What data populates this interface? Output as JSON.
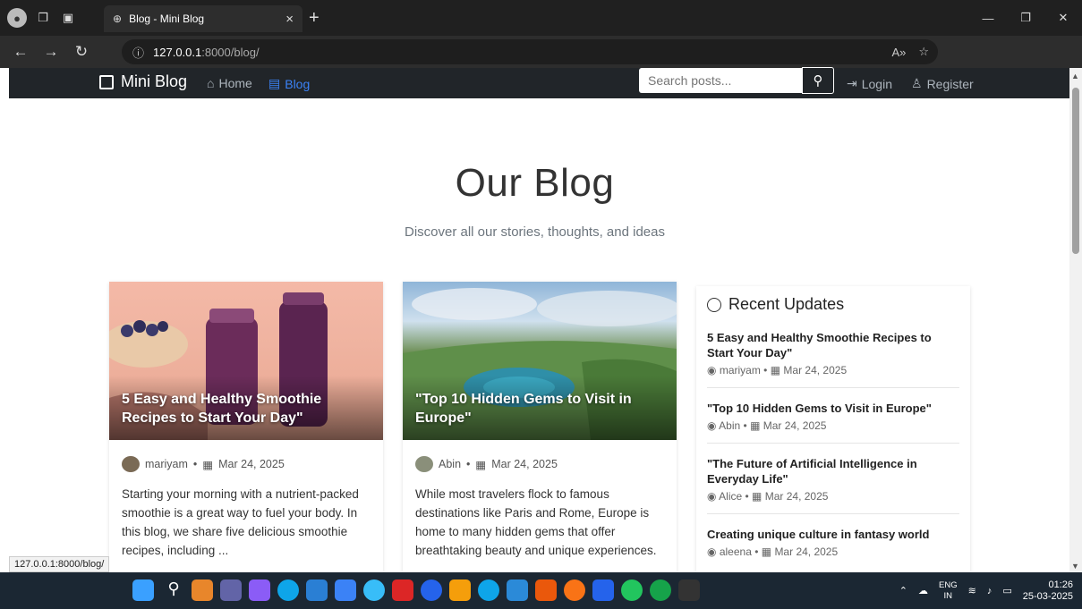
{
  "browser": {
    "tab_title": "Blog - Mini Blog",
    "url_host": "127.0.0.1",
    "url_path": ":8000/blog/",
    "status_url": "127.0.0.1:8000/blog/"
  },
  "navbar": {
    "brand": "Mini Blog",
    "links": {
      "home": "Home",
      "blog": "Blog",
      "login": "Login",
      "register": "Register"
    },
    "search_placeholder": "Search posts..."
  },
  "hero": {
    "title": "Our Blog",
    "subtitle": "Discover all our stories, thoughts, and ideas"
  },
  "posts": [
    {
      "title": "5 Easy and Healthy Smoothie Recipes to Start Your Day\"",
      "author": "mariyam",
      "date": "Mar 24, 2025",
      "excerpt": "Starting your morning with a nutrient-packed smoothie is a great way to fuel your body. In this blog, we share five delicious smoothie recipes, including ..."
    },
    {
      "title": "\"Top 10 Hidden Gems to Visit in Europe\"",
      "author": "Abin",
      "date": "Mar 24, 2025",
      "excerpt": "While most travelers flock to famous destinations like Paris and Rome, Europe is home to many hidden gems that offer breathtaking beauty and unique experiences."
    }
  ],
  "sidebar": {
    "title": "Recent Updates",
    "items": [
      {
        "title": "5 Easy and Healthy Smoothie Recipes to Start Your Day\"",
        "author": "mariyam",
        "date": "Mar 24, 2025"
      },
      {
        "title": "\"Top 10 Hidden Gems to Visit in Europe\"",
        "author": "Abin",
        "date": "Mar 24, 2025"
      },
      {
        "title": "\"The Future of Artificial Intelligence in Everyday Life\"",
        "author": "Alice",
        "date": "Mar 24, 2025"
      },
      {
        "title": "Creating unique culture in fantasy world",
        "author": "aleena",
        "date": "Mar 24, 2025"
      }
    ]
  },
  "taskbar": {
    "lang": "ENG",
    "region": "IN",
    "time": "01:26",
    "date": "25-03-2025"
  }
}
